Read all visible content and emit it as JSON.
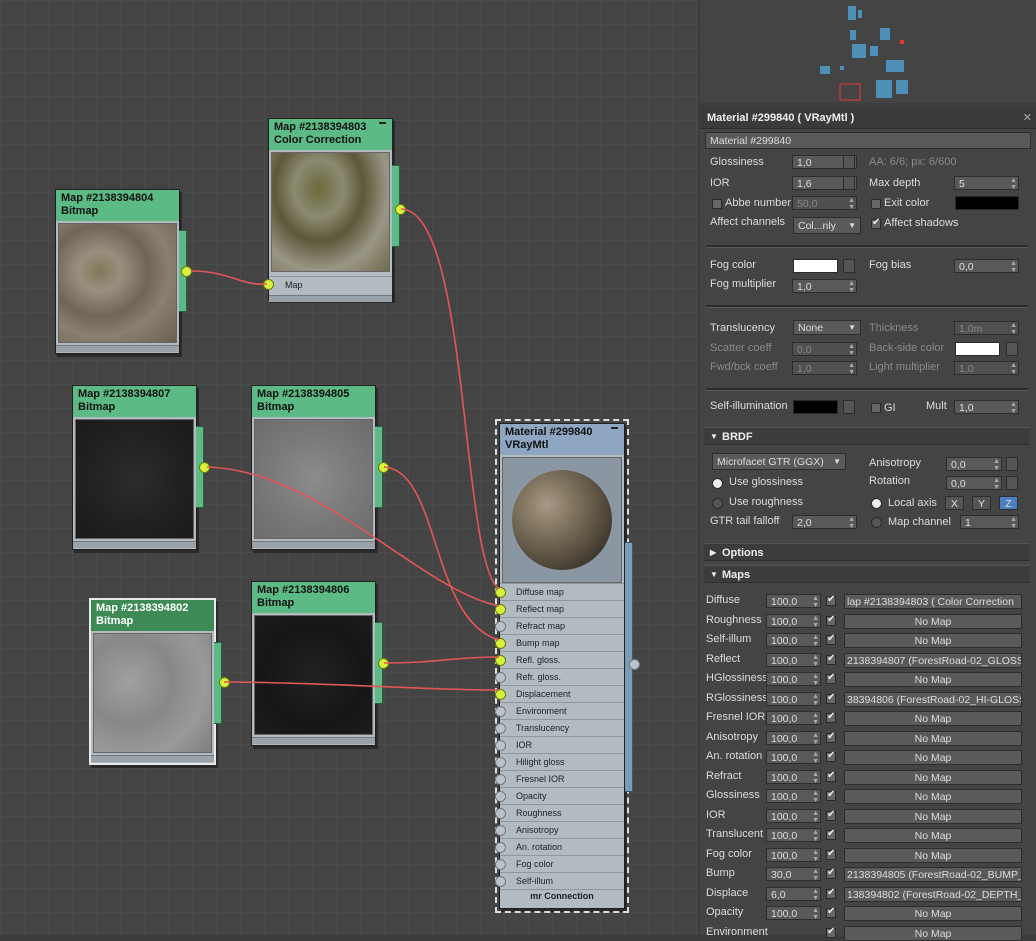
{
  "nodes": {
    "n804": {
      "id": "Map #2138394804",
      "type": "Bitmap"
    },
    "n803": {
      "id": "Map #2138394803",
      "type": "Color Correction",
      "slot": "Map"
    },
    "n807": {
      "id": "Map #2138394807",
      "type": "Bitmap"
    },
    "n805": {
      "id": "Map #2138394805",
      "type": "Bitmap"
    },
    "n802": {
      "id": "Map #2138394802",
      "type": "Bitmap"
    },
    "n806": {
      "id": "Map #2138394806",
      "type": "Bitmap"
    },
    "material": {
      "id": "Material #299840",
      "type": "VRayMtl",
      "slots": [
        "Diffuse map",
        "Reflect map",
        "Refract map",
        "Bump map",
        "Refl. gloss.",
        "Refr. gloss.",
        "Displacement",
        "Environment",
        "Translucency",
        "IOR",
        "Hilight gloss",
        "Fresnel IOR",
        "Opacity",
        "Roughness",
        "Anisotropy",
        "An. rotation",
        "Fog color",
        "Self-illum"
      ],
      "footer": "mr Connection"
    }
  },
  "panel": {
    "title": "Material #299840  ( VRayMtl )",
    "name_field": "Material #299840",
    "glossiness_label": "Glossiness",
    "glossiness": "1,0",
    "aa_label": "AA: 6/6; px: 6/600",
    "ior_label": "IOR",
    "ior": "1,6",
    "max_depth_label": "Max depth",
    "max_depth": "5",
    "abbe_label": "Abbe number",
    "abbe": "50,0",
    "exit_color_label": "Exit color",
    "affect_channels_label": "Affect channels",
    "affect_channels": "Col...nly",
    "affect_shadows_label": "Affect shadows",
    "fog_color_label": "Fog color",
    "fog_bias_label": "Fog bias",
    "fog_bias": "0,0",
    "fog_mult_label": "Fog multiplier",
    "fog_mult": "1,0",
    "translucency_label": "Translucency",
    "translucency": "None",
    "thickness_label": "Thickness",
    "thickness": "1,0m",
    "scatter_label": "Scatter coeff",
    "scatter": "0,0",
    "backside_label": "Back-side color",
    "fwdbck_label": "Fwd/bck coeff",
    "fwdbck": "1,0",
    "light_mult_label": "Light multiplier",
    "light_mult": "1,0",
    "selfillum_label": "Self-illumination",
    "gi_label": "GI",
    "mult_label": "Mult",
    "mult": "1,0"
  },
  "brdf": {
    "title": "BRDF",
    "model": "Microfacet GTR (GGX)",
    "anisotropy_label": "Anisotropy",
    "anisotropy": "0,0",
    "rotation_label": "Rotation",
    "rotation": "0,0",
    "use_gloss": "Use glossiness",
    "use_rough": "Use roughness",
    "local_axis": "Local axis",
    "axes": [
      "X",
      "Y",
      "Z"
    ],
    "map_channel": "Map channel",
    "map_channel_val": "1",
    "gtr_label": "GTR tail falloff",
    "gtr": "2,0"
  },
  "options_title": "Options",
  "maps": {
    "title": "Maps",
    "rows": [
      {
        "label": "Diffuse",
        "amount": "100,0",
        "map": "lap #2138394803  ( Color Correction"
      },
      {
        "label": "Roughness",
        "amount": "100,0",
        "map": "No Map"
      },
      {
        "label": "Self-illum",
        "amount": "100,0",
        "map": "No Map"
      },
      {
        "label": "Reflect",
        "amount": "100,0",
        "map": "2138394807 (ForestRoad-02_GLOSS_"
      },
      {
        "label": "HGlossiness",
        "amount": "100,0",
        "map": "No Map"
      },
      {
        "label": "RGlossiness",
        "amount": "100,0",
        "map": "38394806 (ForestRoad-02_HI-GLOSS"
      },
      {
        "label": "Fresnel IOR",
        "amount": "100,0",
        "map": "No Map"
      },
      {
        "label": "Anisotropy",
        "amount": "100,0",
        "map": "No Map"
      },
      {
        "label": "An. rotation",
        "amount": "100,0",
        "map": "No Map"
      },
      {
        "label": "Refract",
        "amount": "100,0",
        "map": "No Map"
      },
      {
        "label": "Glossiness",
        "amount": "100,0",
        "map": "No Map"
      },
      {
        "label": "IOR",
        "amount": "100,0",
        "map": "No Map"
      },
      {
        "label": "Translucent",
        "amount": "100,0",
        "map": "No Map"
      },
      {
        "label": "Fog color",
        "amount": "100,0",
        "map": "No Map"
      },
      {
        "label": "Bump",
        "amount": "30,0",
        "map": "2138394805 (ForestRoad-02_BUMP_"
      },
      {
        "label": "Displace",
        "amount": "6,0",
        "map": "138394802 (ForestRoad-02_DEPTH_"
      },
      {
        "label": "Opacity",
        "amount": "100,0",
        "map": "No Map"
      },
      {
        "label": "Environment",
        "amount": "",
        "map": "No Map"
      }
    ]
  }
}
